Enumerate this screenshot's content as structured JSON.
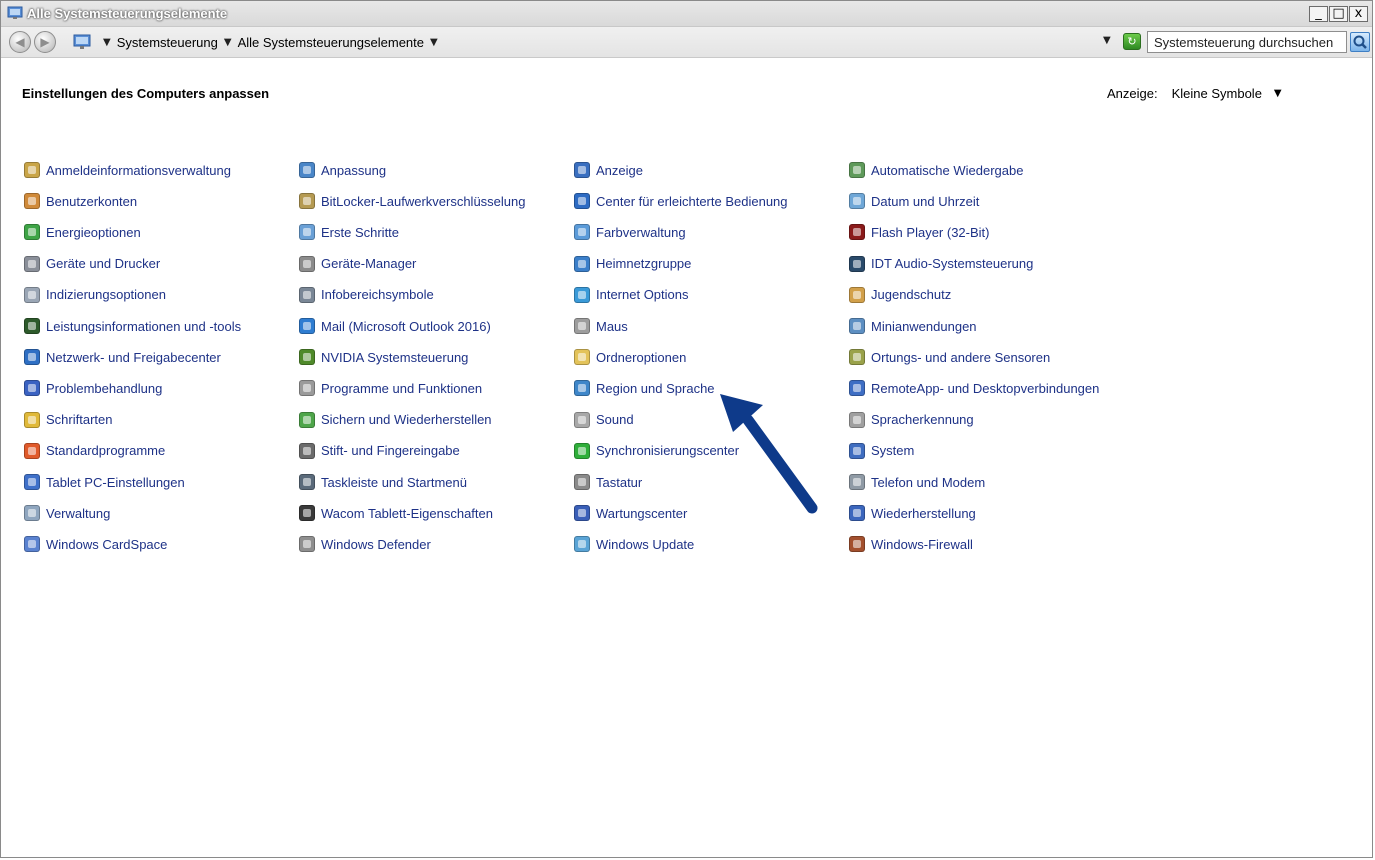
{
  "window": {
    "title": "Alle Systemsteuerungselemente",
    "controls": {
      "minimize": "_",
      "maximize": "□",
      "close": "x"
    }
  },
  "address": {
    "crumbs": [
      "Systemsteuerung",
      "Alle Systemsteuerungselemente"
    ],
    "search_placeholder": "Systemsteuerung durchsuchen"
  },
  "content": {
    "heading": "Einstellungen des Computers anpassen",
    "view_label": "Anzeige:",
    "view_value": "Kleine Symbole"
  },
  "columns": [
    [
      {
        "label": "Anmeldeinformationsverwaltung",
        "icon": "credential-manager-icon",
        "color": "#c9a548"
      },
      {
        "label": "Benutzerkonten",
        "icon": "user-accounts-icon",
        "color": "#d08a3a"
      },
      {
        "label": "Energieoptionen",
        "icon": "power-options-icon",
        "color": "#3ea446"
      },
      {
        "label": "Geräte und Drucker",
        "icon": "devices-printers-icon",
        "color": "#8a8f99"
      },
      {
        "label": "Indizierungsoptionen",
        "icon": "indexing-options-icon",
        "color": "#9aa6b5"
      },
      {
        "label": "Leistungsinformationen und -tools",
        "icon": "performance-icon",
        "color": "#2d5a2b"
      },
      {
        "label": "Netzwerk- und Freigabecenter",
        "icon": "network-center-icon",
        "color": "#2e6fc4"
      },
      {
        "label": "Problembehandlung",
        "icon": "troubleshooting-icon",
        "color": "#3a62c2"
      },
      {
        "label": "Schriftarten",
        "icon": "fonts-icon",
        "color": "#e0b93a"
      },
      {
        "label": "Standardprogramme",
        "icon": "default-programs-icon",
        "color": "#e05a2a"
      },
      {
        "label": "Tablet PC-Einstellungen",
        "icon": "tablet-settings-icon",
        "color": "#3f70c9"
      },
      {
        "label": "Verwaltung",
        "icon": "administration-icon",
        "color": "#8fa6bf"
      },
      {
        "label": "Windows CardSpace",
        "icon": "cardspace-icon",
        "color": "#5a82d0"
      }
    ],
    [
      {
        "label": "Anpassung",
        "icon": "personalization-icon",
        "color": "#4a86c8"
      },
      {
        "label": "BitLocker-Laufwerkverschlüsselung",
        "icon": "bitlocker-icon",
        "color": "#b59a52"
      },
      {
        "label": "Erste Schritte",
        "icon": "getting-started-icon",
        "color": "#6aa0d6"
      },
      {
        "label": "Geräte-Manager",
        "icon": "device-manager-icon",
        "color": "#8c8c8c"
      },
      {
        "label": "Infobereichsymbole",
        "icon": "notification-icons-icon",
        "color": "#7a8796"
      },
      {
        "label": "Mail (Microsoft Outlook 2016)",
        "icon": "mail-icon",
        "color": "#2f7dd1"
      },
      {
        "label": "NVIDIA Systemsteuerung",
        "icon": "nvidia-icon",
        "color": "#4f8a2a"
      },
      {
        "label": "Programme und Funktionen",
        "icon": "programs-features-icon",
        "color": "#9a9a9a"
      },
      {
        "label": "Sichern und Wiederherstellen",
        "icon": "backup-restore-icon",
        "color": "#4ea54a"
      },
      {
        "label": "Stift- und Fingereingabe",
        "icon": "pen-touch-icon",
        "color": "#6b6b6b"
      },
      {
        "label": "Taskleiste und Startmenü",
        "icon": "taskbar-icon",
        "color": "#5a6a7a"
      },
      {
        "label": "Wacom Tablett-Eigenschaften",
        "icon": "wacom-icon",
        "color": "#3a3a3a"
      },
      {
        "label": "Windows Defender",
        "icon": "windows-defender-icon",
        "color": "#8f8f8f"
      }
    ],
    [
      {
        "label": "Anzeige",
        "icon": "display-icon",
        "color": "#3a6fc0"
      },
      {
        "label": "Center für erleichterte Bedienung",
        "icon": "ease-of-access-icon",
        "color": "#2d6bc3"
      },
      {
        "label": "Farbverwaltung",
        "icon": "color-management-icon",
        "color": "#5b9bd9"
      },
      {
        "label": "Heimnetzgruppe",
        "icon": "homegroup-icon",
        "color": "#3b7fca"
      },
      {
        "label": "Internet Options",
        "icon": "internet-options-icon",
        "color": "#3a9ad8"
      },
      {
        "label": "Maus",
        "icon": "mouse-icon",
        "color": "#9d9d9d"
      },
      {
        "label": "Ordneroptionen",
        "icon": "folder-options-icon",
        "color": "#e3c35a"
      },
      {
        "label": "Region und Sprache",
        "icon": "region-language-icon",
        "color": "#3e86c9"
      },
      {
        "label": "Sound",
        "icon": "sound-icon",
        "color": "#a8a8a8"
      },
      {
        "label": "Synchronisierungscenter",
        "icon": "sync-center-icon",
        "color": "#2fae3a"
      },
      {
        "label": "Tastatur",
        "icon": "keyboard-icon",
        "color": "#8a8a8a"
      },
      {
        "label": "Wartungscenter",
        "icon": "action-center-icon",
        "color": "#3a5fb8"
      },
      {
        "label": "Windows Update",
        "icon": "windows-update-icon",
        "color": "#5aa4d6"
      }
    ],
    [
      {
        "label": "Automatische Wiedergabe",
        "icon": "autoplay-icon",
        "color": "#5f9a5a"
      },
      {
        "label": "Datum und Uhrzeit",
        "icon": "date-time-icon",
        "color": "#6fa7d7"
      },
      {
        "label": "Flash Player (32-Bit)",
        "icon": "flash-player-icon",
        "color": "#8a1a1a"
      },
      {
        "label": "IDT Audio-Systemsteuerung",
        "icon": "idt-audio-icon",
        "color": "#2a4a6a"
      },
      {
        "label": "Jugendschutz",
        "icon": "parental-controls-icon",
        "color": "#d2a04a"
      },
      {
        "label": "Minianwendungen",
        "icon": "gadgets-icon",
        "color": "#5d8fc2"
      },
      {
        "label": "Ortungs- und andere Sensoren",
        "icon": "sensors-icon",
        "color": "#9aa24a"
      },
      {
        "label": "RemoteApp- und Desktopverbindungen",
        "icon": "remoteapp-icon",
        "color": "#3e6ec4"
      },
      {
        "label": "Spracherkennung",
        "icon": "speech-recognition-icon",
        "color": "#a0a0a0"
      },
      {
        "label": "System",
        "icon": "system-icon",
        "color": "#3f6dc0"
      },
      {
        "label": "Telefon und Modem",
        "icon": "phone-modem-icon",
        "color": "#8f9aa5"
      },
      {
        "label": "Wiederherstellung",
        "icon": "recovery-icon",
        "color": "#3b66bd"
      },
      {
        "label": "Windows-Firewall",
        "icon": "firewall-icon",
        "color": "#a3502e"
      }
    ]
  ],
  "colors": {
    "link": "#1e3287",
    "annotation_arrow": "#0e3a8a"
  }
}
